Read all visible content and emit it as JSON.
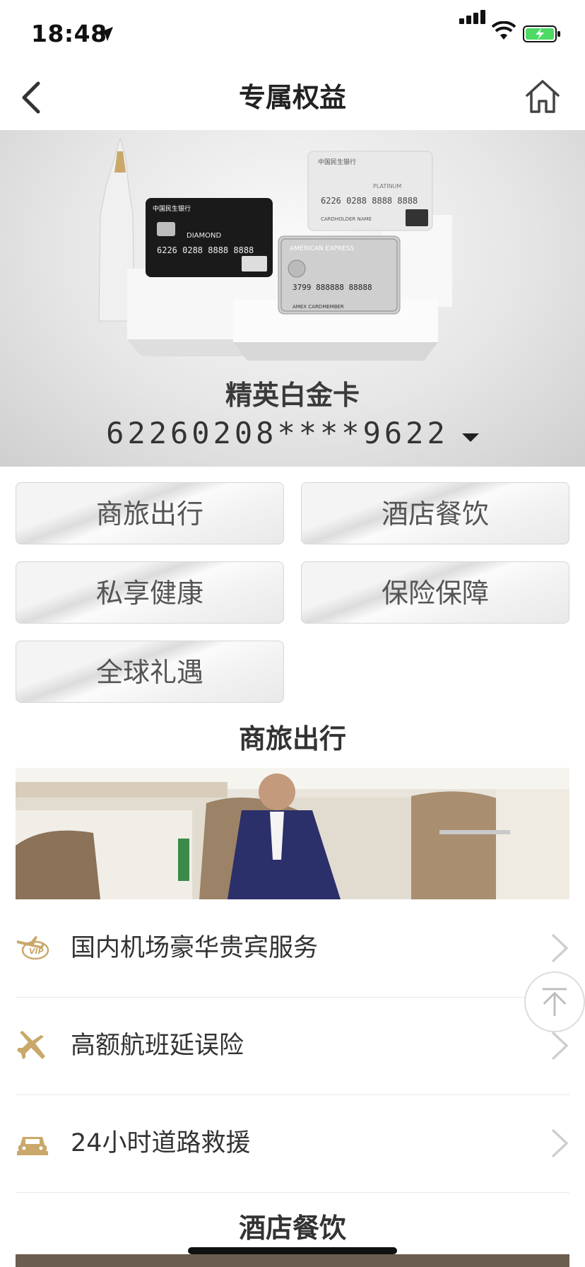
{
  "status_bar": {
    "time": "18:48"
  },
  "nav": {
    "title": "专属权益"
  },
  "hero": {
    "card_name": "精英白金卡",
    "card_number": "62260208****9622"
  },
  "categories": [
    {
      "label": "商旅出行"
    },
    {
      "label": "酒店餐饮"
    },
    {
      "label": "私享健康"
    },
    {
      "label": "保险保障"
    },
    {
      "label": "全球礼遇"
    }
  ],
  "sections": [
    {
      "title": "商旅出行",
      "items": [
        {
          "label": "国内机场豪华贵宾服务",
          "icon": "vip-plane-icon"
        },
        {
          "label": "高额航班延误险",
          "icon": "plane-icon"
        },
        {
          "label": "24小时道路救援",
          "icon": "car-icon"
        }
      ]
    },
    {
      "title": "酒店餐饮"
    }
  ],
  "colors": {
    "accent_gold": "#c9a86a",
    "title_text": "#222222",
    "button_text": "#555555"
  }
}
